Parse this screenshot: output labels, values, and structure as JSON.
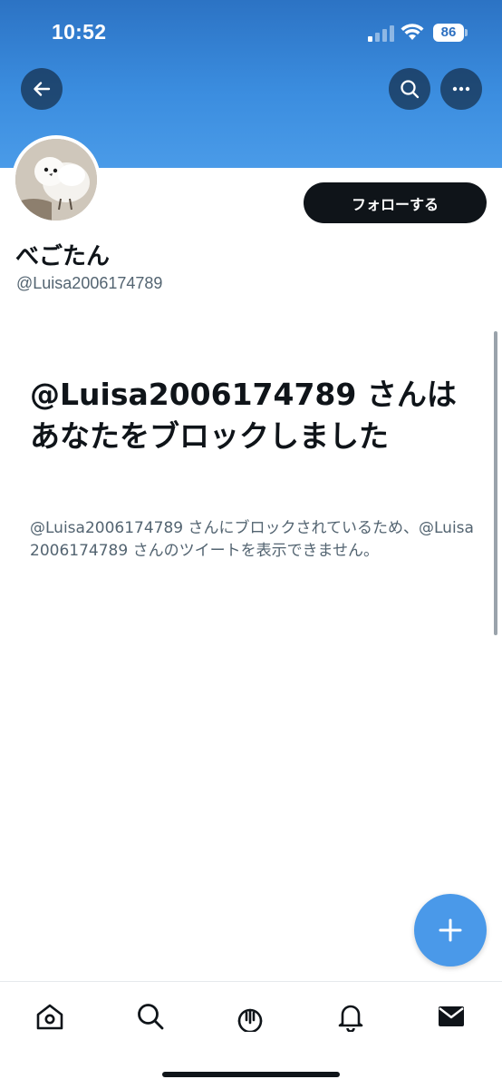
{
  "status_bar": {
    "time": "10:52",
    "battery": "86"
  },
  "profile": {
    "display_name": "べごたん",
    "handle": "@Luisa2006174789",
    "follow_button_label": "フォローする"
  },
  "blocked_notice": {
    "title": "@Luisa2006174789 さんはあなたをブロックしました",
    "description": "@Luisa2006174789 さんにブロックされているため、@Luisa2006174789 さんのツイートを表示できません。"
  },
  "icons": {
    "back": "arrow-left-icon",
    "search": "search-icon",
    "more": "more-horizontal-icon",
    "compose": "plus-icon",
    "tabs": [
      "home-icon",
      "search-icon",
      "spaces-icon",
      "bell-icon",
      "mail-icon"
    ]
  },
  "colors": {
    "header_top": "#2c73c4",
    "header_bottom": "#4a9be8",
    "follow_button": "#0f1419",
    "fab": "#4a99e9",
    "secondary_text": "#536471"
  }
}
